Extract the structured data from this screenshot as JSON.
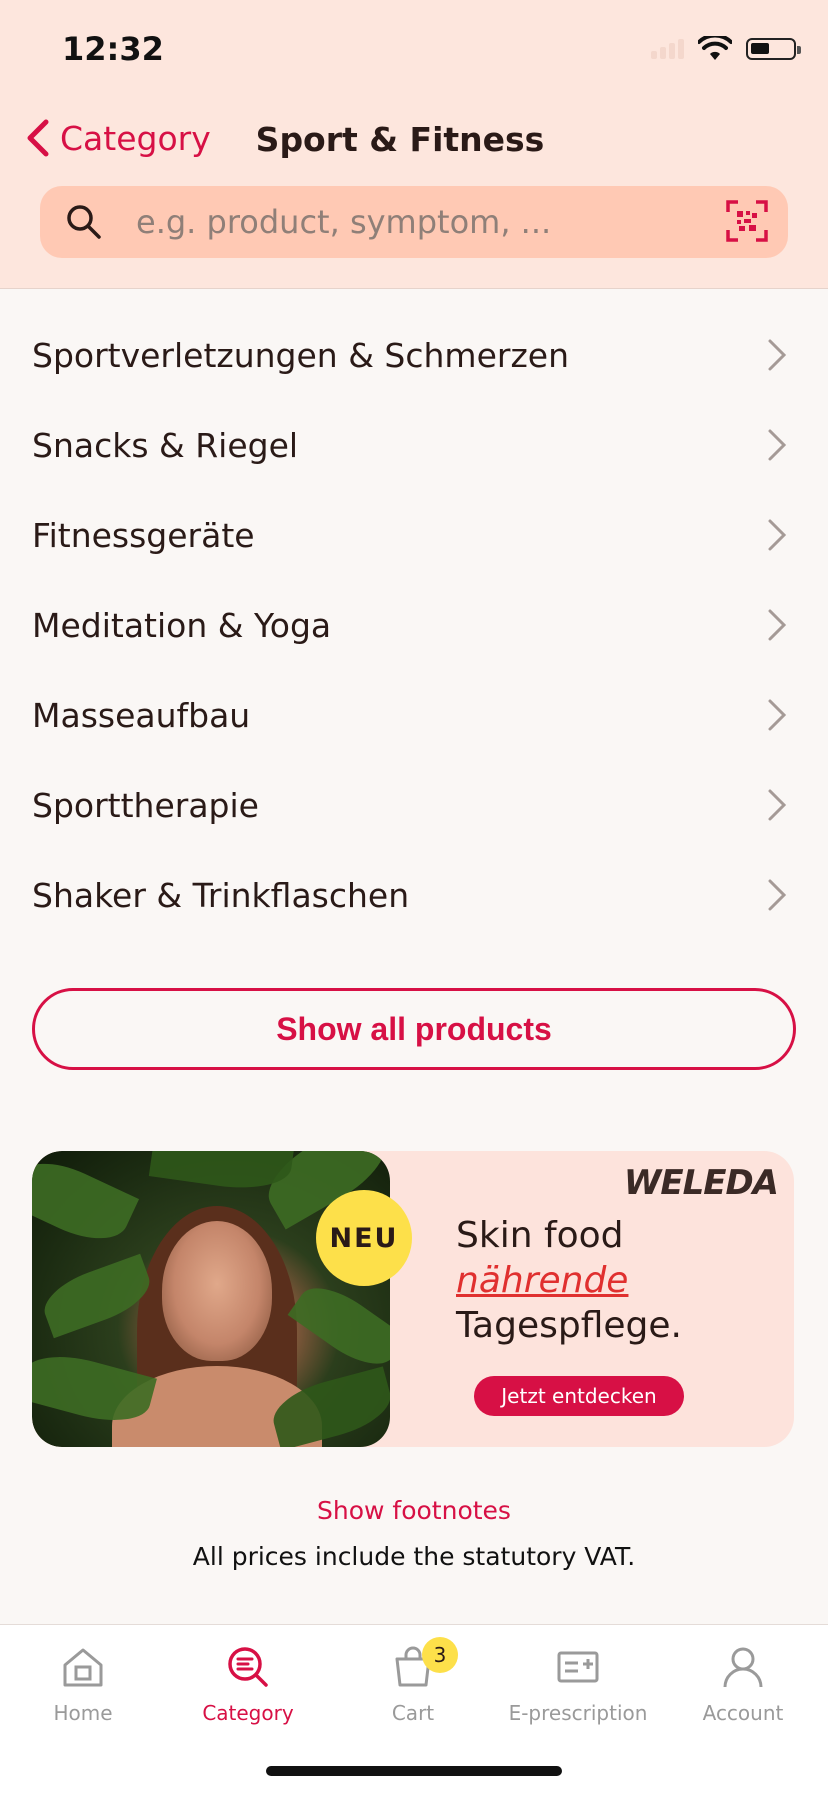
{
  "status_bar": {
    "time": "12:32"
  },
  "nav": {
    "back_label": "Category",
    "title": "Sport & Fitness"
  },
  "search": {
    "placeholder": "e.g. product, symptom, ..."
  },
  "categories": [
    {
      "label": "Sportverletzungen & Schmerzen"
    },
    {
      "label": "Snacks & Riegel"
    },
    {
      "label": "Fitnessgeräte"
    },
    {
      "label": "Meditation & Yoga"
    },
    {
      "label": "Masseaufbau"
    },
    {
      "label": "Sporttherapie"
    },
    {
      "label": "Shaker & Trinkflaschen"
    }
  ],
  "show_all_label": "Show all products",
  "banner": {
    "badge": "NEU",
    "brand": "WELEDA",
    "line1": "Skin food",
    "line2": "nährende",
    "line3": "Tagespflege.",
    "cta": "Jetzt entdecken"
  },
  "footer": {
    "footnotes_link": "Show footnotes",
    "vat_note": "All prices include the statutory VAT."
  },
  "tabbar": {
    "home": "Home",
    "category": "Category",
    "cart": "Cart",
    "cart_badge": "3",
    "eprescription": "E-prescription",
    "account": "Account"
  },
  "colors": {
    "accent": "#d71045",
    "header_bg": "#fde6dd",
    "search_bg": "#ffc9b4",
    "badge_yellow": "#fde04a"
  }
}
